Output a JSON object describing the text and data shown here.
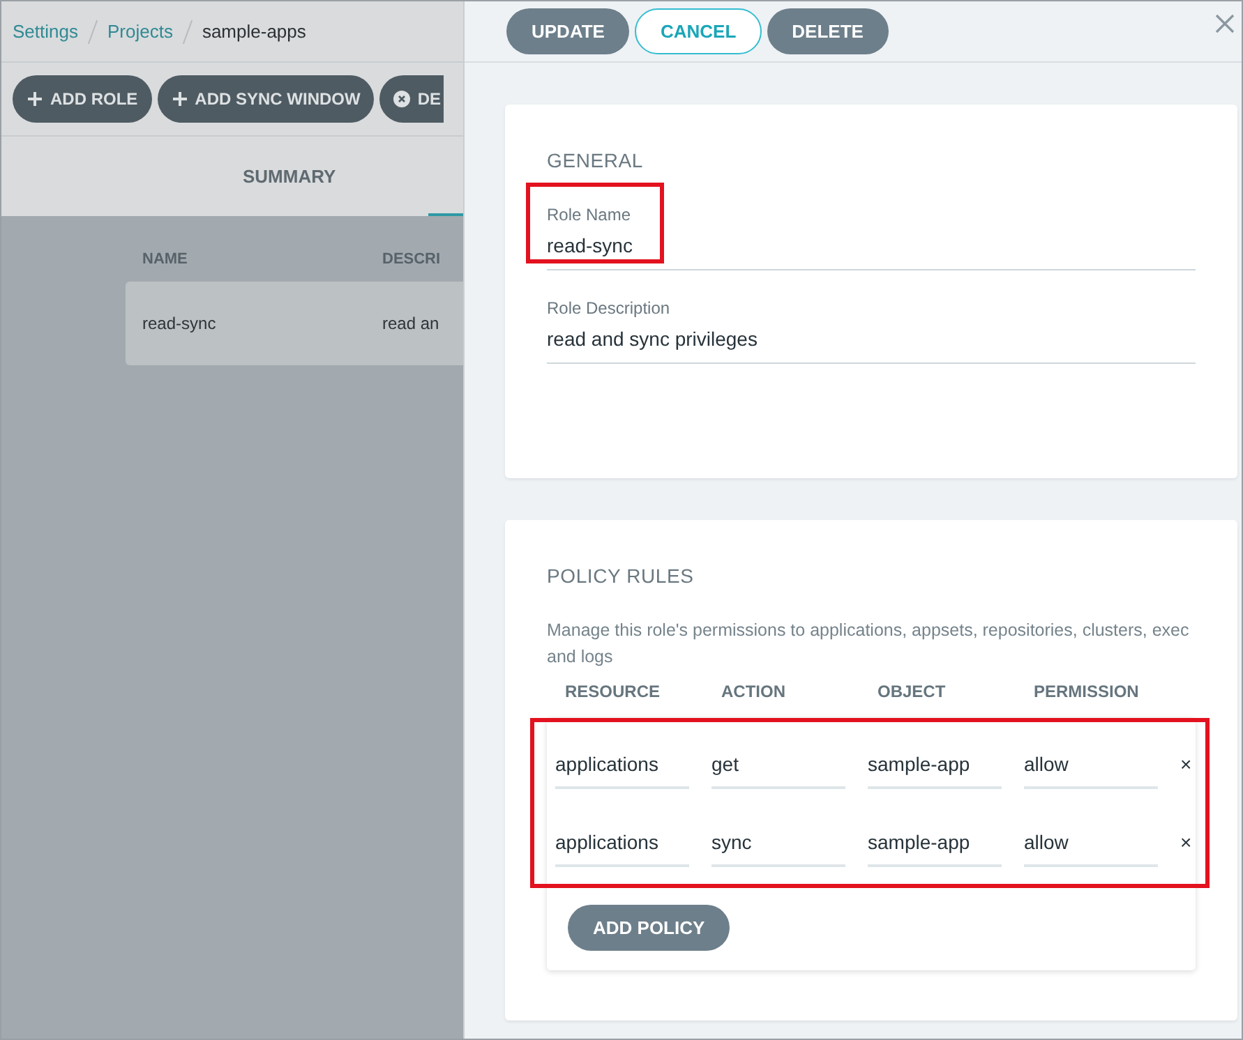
{
  "breadcrumbs": [
    {
      "label": "Settings",
      "kind": "link"
    },
    {
      "label": "Projects",
      "kind": "link"
    },
    {
      "label": "sample-apps",
      "kind": "current"
    }
  ],
  "toolbar": [
    {
      "label": "ADD ROLE",
      "kind": "add"
    },
    {
      "label": "ADD SYNC WINDOW",
      "kind": "add"
    },
    {
      "label": "DE",
      "kind": "delete"
    }
  ],
  "tabs": [
    {
      "label": "SUMMARY",
      "selected": false
    }
  ],
  "roles_table": {
    "columns": [
      "NAME",
      "DESCRI"
    ],
    "rows": [
      [
        "read-sync",
        "read an"
      ]
    ]
  },
  "panel": {
    "buttons": [
      {
        "label": "UPDATE",
        "kind": "filled"
      },
      {
        "label": "CANCEL",
        "kind": "outline"
      },
      {
        "label": "DELETE",
        "kind": "filled"
      }
    ],
    "general": {
      "title": "GENERAL",
      "fields": [
        {
          "label": "Role Name",
          "value": "read-sync",
          "highlighted": true
        },
        {
          "label": "Role Description",
          "value": "read and sync privileges",
          "highlighted": false
        }
      ]
    },
    "policy_rules": {
      "title": "POLICY RULES",
      "description": "Manage this role's permissions to applications, appsets, repositories, clusters, exec and logs",
      "columns": [
        "RESOURCE",
        "ACTION",
        "OBJECT",
        "PERMISSION"
      ],
      "rows": [
        [
          "applications",
          "get",
          "sample-app",
          "allow"
        ],
        [
          "applications",
          "sync",
          "sample-app",
          "allow"
        ]
      ],
      "remove_symbol": "×",
      "add_button": "ADD POLICY"
    }
  }
}
